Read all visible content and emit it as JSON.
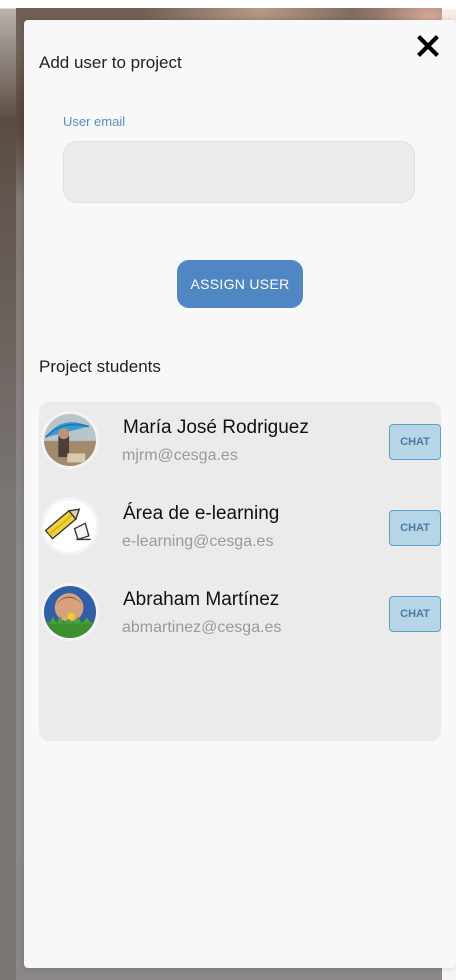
{
  "modal": {
    "title": "Add user to project",
    "close_icon": "close-icon"
  },
  "form": {
    "email_label": "User email",
    "email_value": "",
    "email_placeholder": "",
    "assign_label": "ASSIGN USER"
  },
  "students": {
    "title": "Project students",
    "chat_label": "CHAT",
    "items": [
      {
        "name": "María José Rodriguez",
        "email": "mjrm@cesga.es",
        "avatar": "photo-umbrella-avatar"
      },
      {
        "name": "Área de e-learning",
        "email": "e-learning@cesga.es",
        "avatar": "pencil-logo-avatar"
      },
      {
        "name": "Abraham Martínez",
        "email": "abmartinez@cesga.es",
        "avatar": "photo-child-flower-avatar"
      }
    ]
  },
  "colors": {
    "accent": "#4f87c4",
    "label": "#5b8fc7",
    "chat_bg": "#b6d6e8",
    "chat_border": "#5aa0c9",
    "chat_text": "#4d7aa5"
  }
}
